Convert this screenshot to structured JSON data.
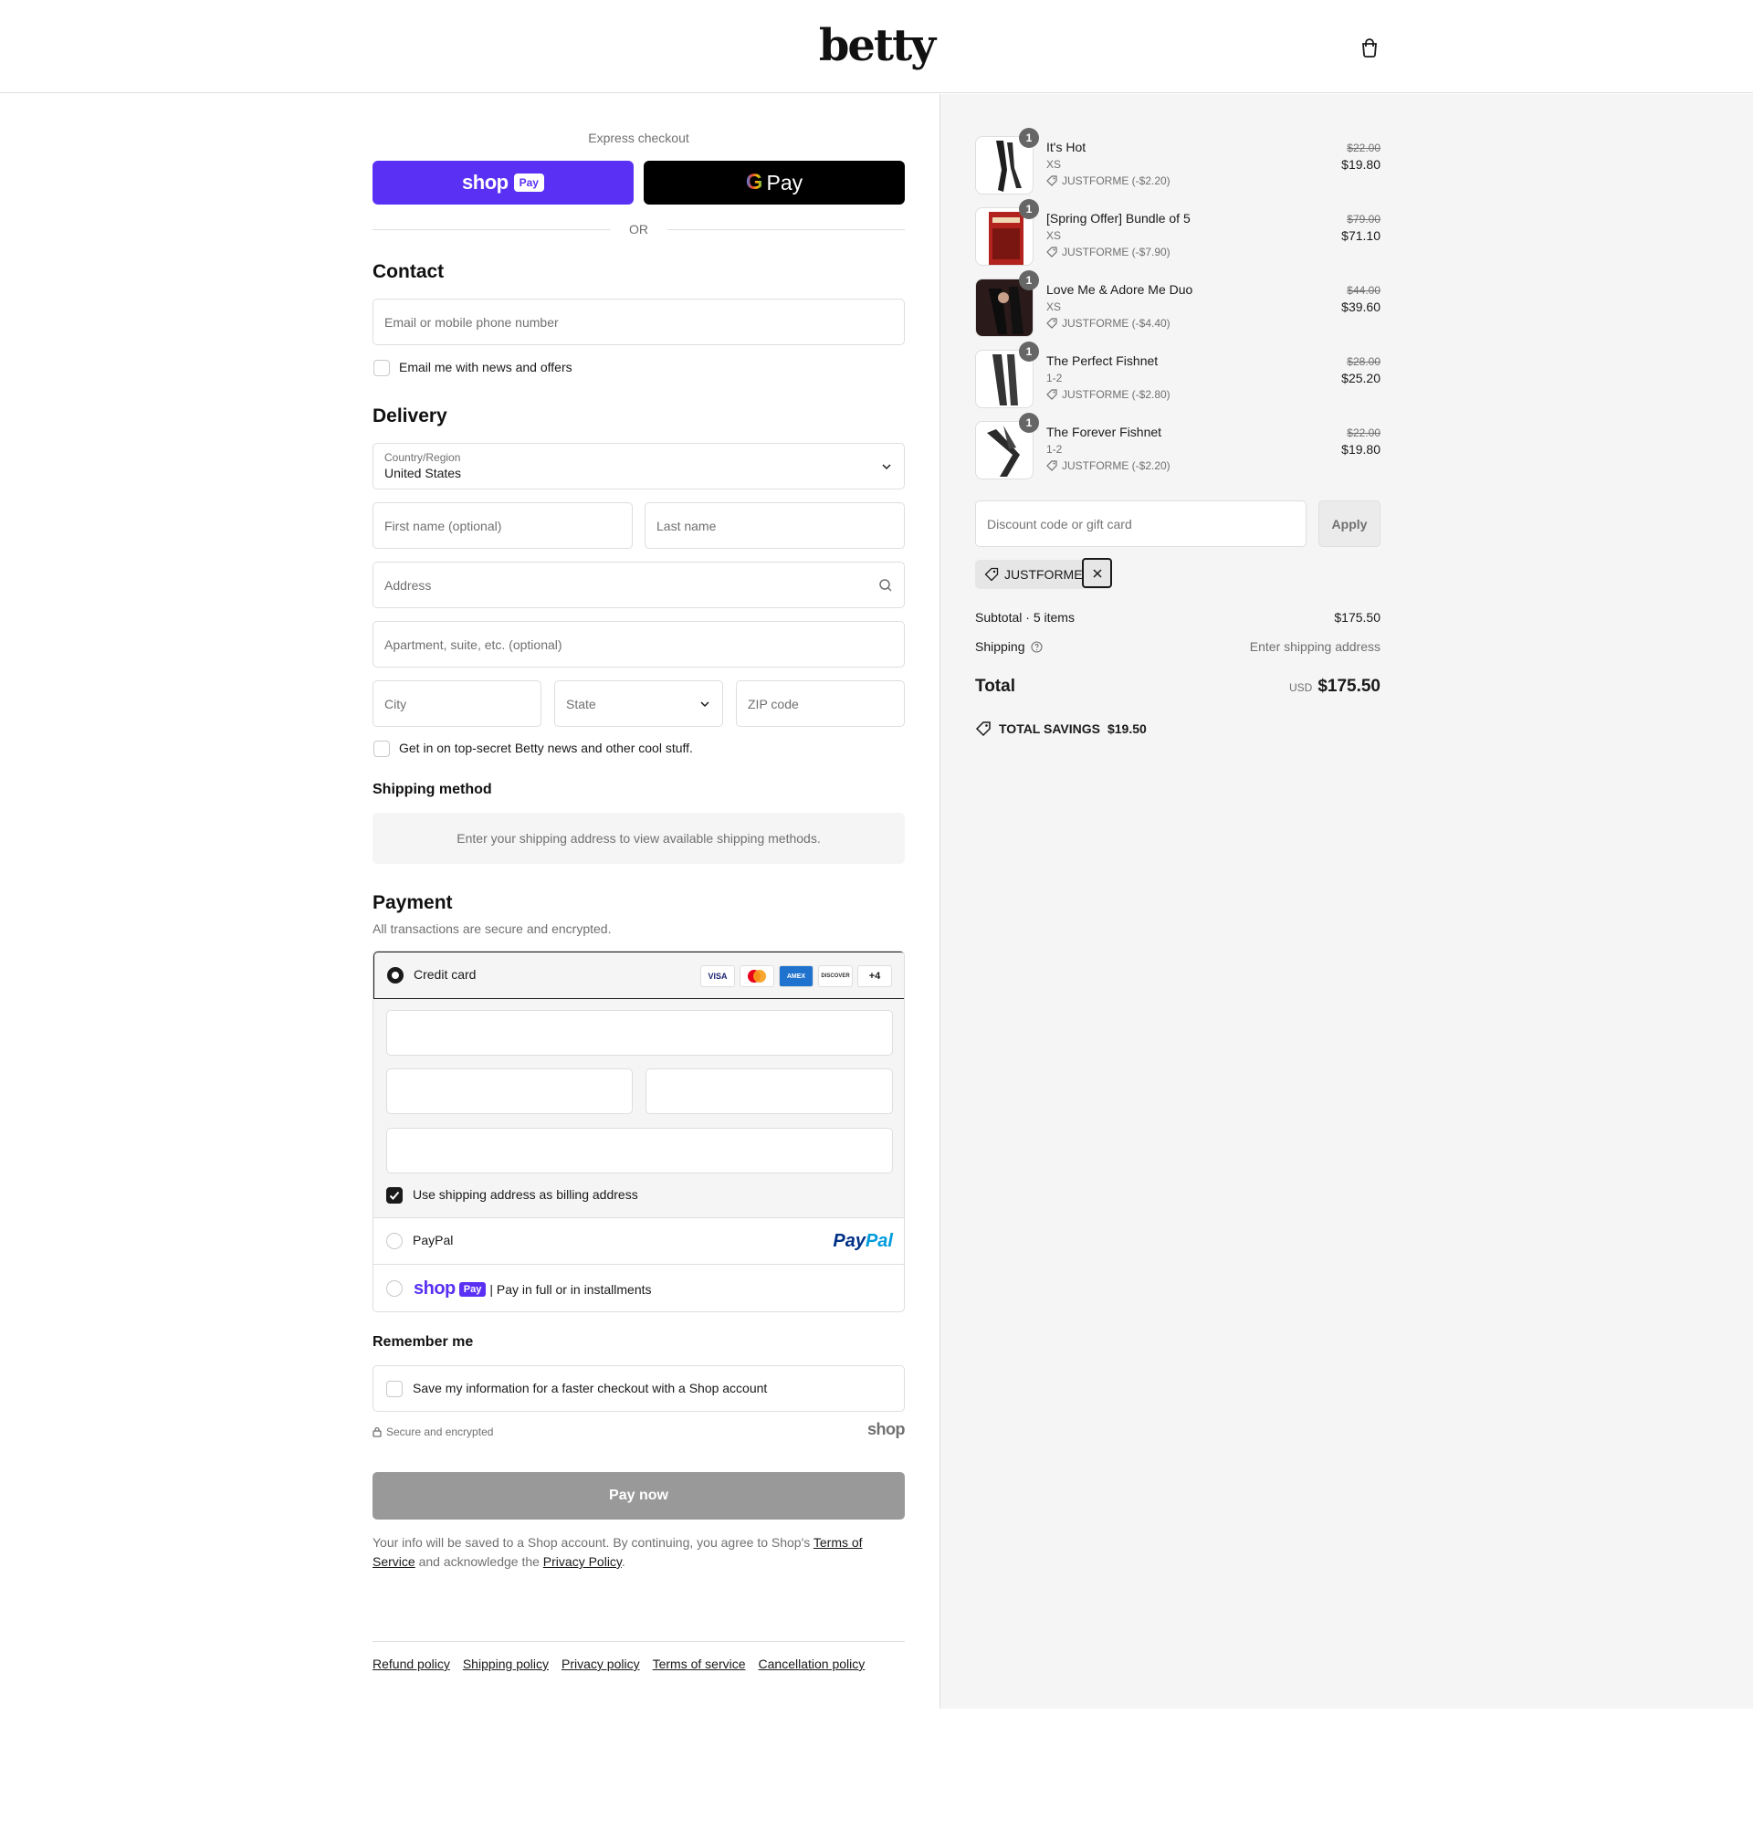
{
  "brand": {
    "name": "betty"
  },
  "express": {
    "label": "Express checkout",
    "shop_pay_word": "shop",
    "shop_pay_pill": "Pay",
    "gpay_letter": "G",
    "gpay_word": "Pay",
    "or": "OR"
  },
  "contact": {
    "title": "Contact",
    "email_placeholder": "Email or mobile phone number",
    "news_label": "Email me with news and offers"
  },
  "delivery": {
    "title": "Delivery",
    "country_label": "Country/Region",
    "country_value": "United States",
    "first_name_placeholder": "First name (optional)",
    "last_name_placeholder": "Last name",
    "address_placeholder": "Address",
    "apartment_placeholder": "Apartment, suite, etc. (optional)",
    "city_placeholder": "City",
    "state_placeholder": "State",
    "zip_placeholder": "ZIP code",
    "betty_news_label": "Get in on top-secret Betty news and other cool stuff."
  },
  "shipping_method": {
    "title": "Shipping method",
    "message": "Enter your shipping address to view available shipping methods."
  },
  "payment": {
    "title": "Payment",
    "note": "All transactions are secure and encrypted.",
    "credit_card_label": "Credit card",
    "card_brands": [
      "VISA",
      "MC",
      "AMEX",
      "DISCOVER",
      "+4"
    ],
    "billing_label": "Use shipping address as billing address",
    "paypal_label": "PayPal",
    "paypal_logo_a": "Pay",
    "paypal_logo_b": "Pal",
    "shop_word": "shop",
    "shop_pill": "Pay",
    "shop_installments": "| Pay in full or in installments"
  },
  "remember": {
    "title": "Remember me",
    "save_label": "Save my information for a faster checkout with a Shop account",
    "secure": "Secure and encrypted",
    "shop_logo": "shop"
  },
  "pay_now": "Pay now",
  "legal": {
    "text_1": "Your info will be saved to a Shop account. By continuing, you agree to Shop's",
    "terms_link": "Terms of Service",
    "text_2": "and acknowledge the",
    "privacy_link": "Privacy Policy",
    "text_3": "."
  },
  "footer_links": [
    "Refund policy",
    "Shipping policy",
    "Privacy policy",
    "Terms of service",
    "Cancellation policy"
  ],
  "order": {
    "items": [
      {
        "qty": "1",
        "name": "It's Hot",
        "variant": "XS",
        "discount": "JUSTFORME (-$2.20)",
        "old_price": "$22.00",
        "price": "$19.80"
      },
      {
        "qty": "1",
        "name": "[Spring Offer] Bundle of 5",
        "variant": "XS",
        "discount": "JUSTFORME (-$7.90)",
        "old_price": "$79.00",
        "price": "$71.10"
      },
      {
        "qty": "1",
        "name": "Love Me & Adore Me Duo",
        "variant": "XS",
        "discount": "JUSTFORME (-$4.40)",
        "old_price": "$44.00",
        "price": "$39.60"
      },
      {
        "qty": "1",
        "name": "The Perfect Fishnet",
        "variant": "1-2",
        "discount": "JUSTFORME (-$2.80)",
        "old_price": "$28.00",
        "price": "$25.20"
      },
      {
        "qty": "1",
        "name": "The Forever Fishnet",
        "variant": "1-2",
        "discount": "JUSTFORME (-$2.20)",
        "old_price": "$22.00",
        "price": "$19.80"
      }
    ],
    "discount_placeholder": "Discount code or gift card",
    "apply": "Apply",
    "applied_code": "JUSTFORME",
    "subtotal_label": "Subtotal · 5 items",
    "subtotal_value": "$175.50",
    "shipping_label": "Shipping",
    "shipping_value": "Enter shipping address",
    "total_label": "Total",
    "currency": "USD",
    "total_value": "$175.50",
    "savings_label": "TOTAL SAVINGS",
    "savings_value": "$19.50"
  }
}
